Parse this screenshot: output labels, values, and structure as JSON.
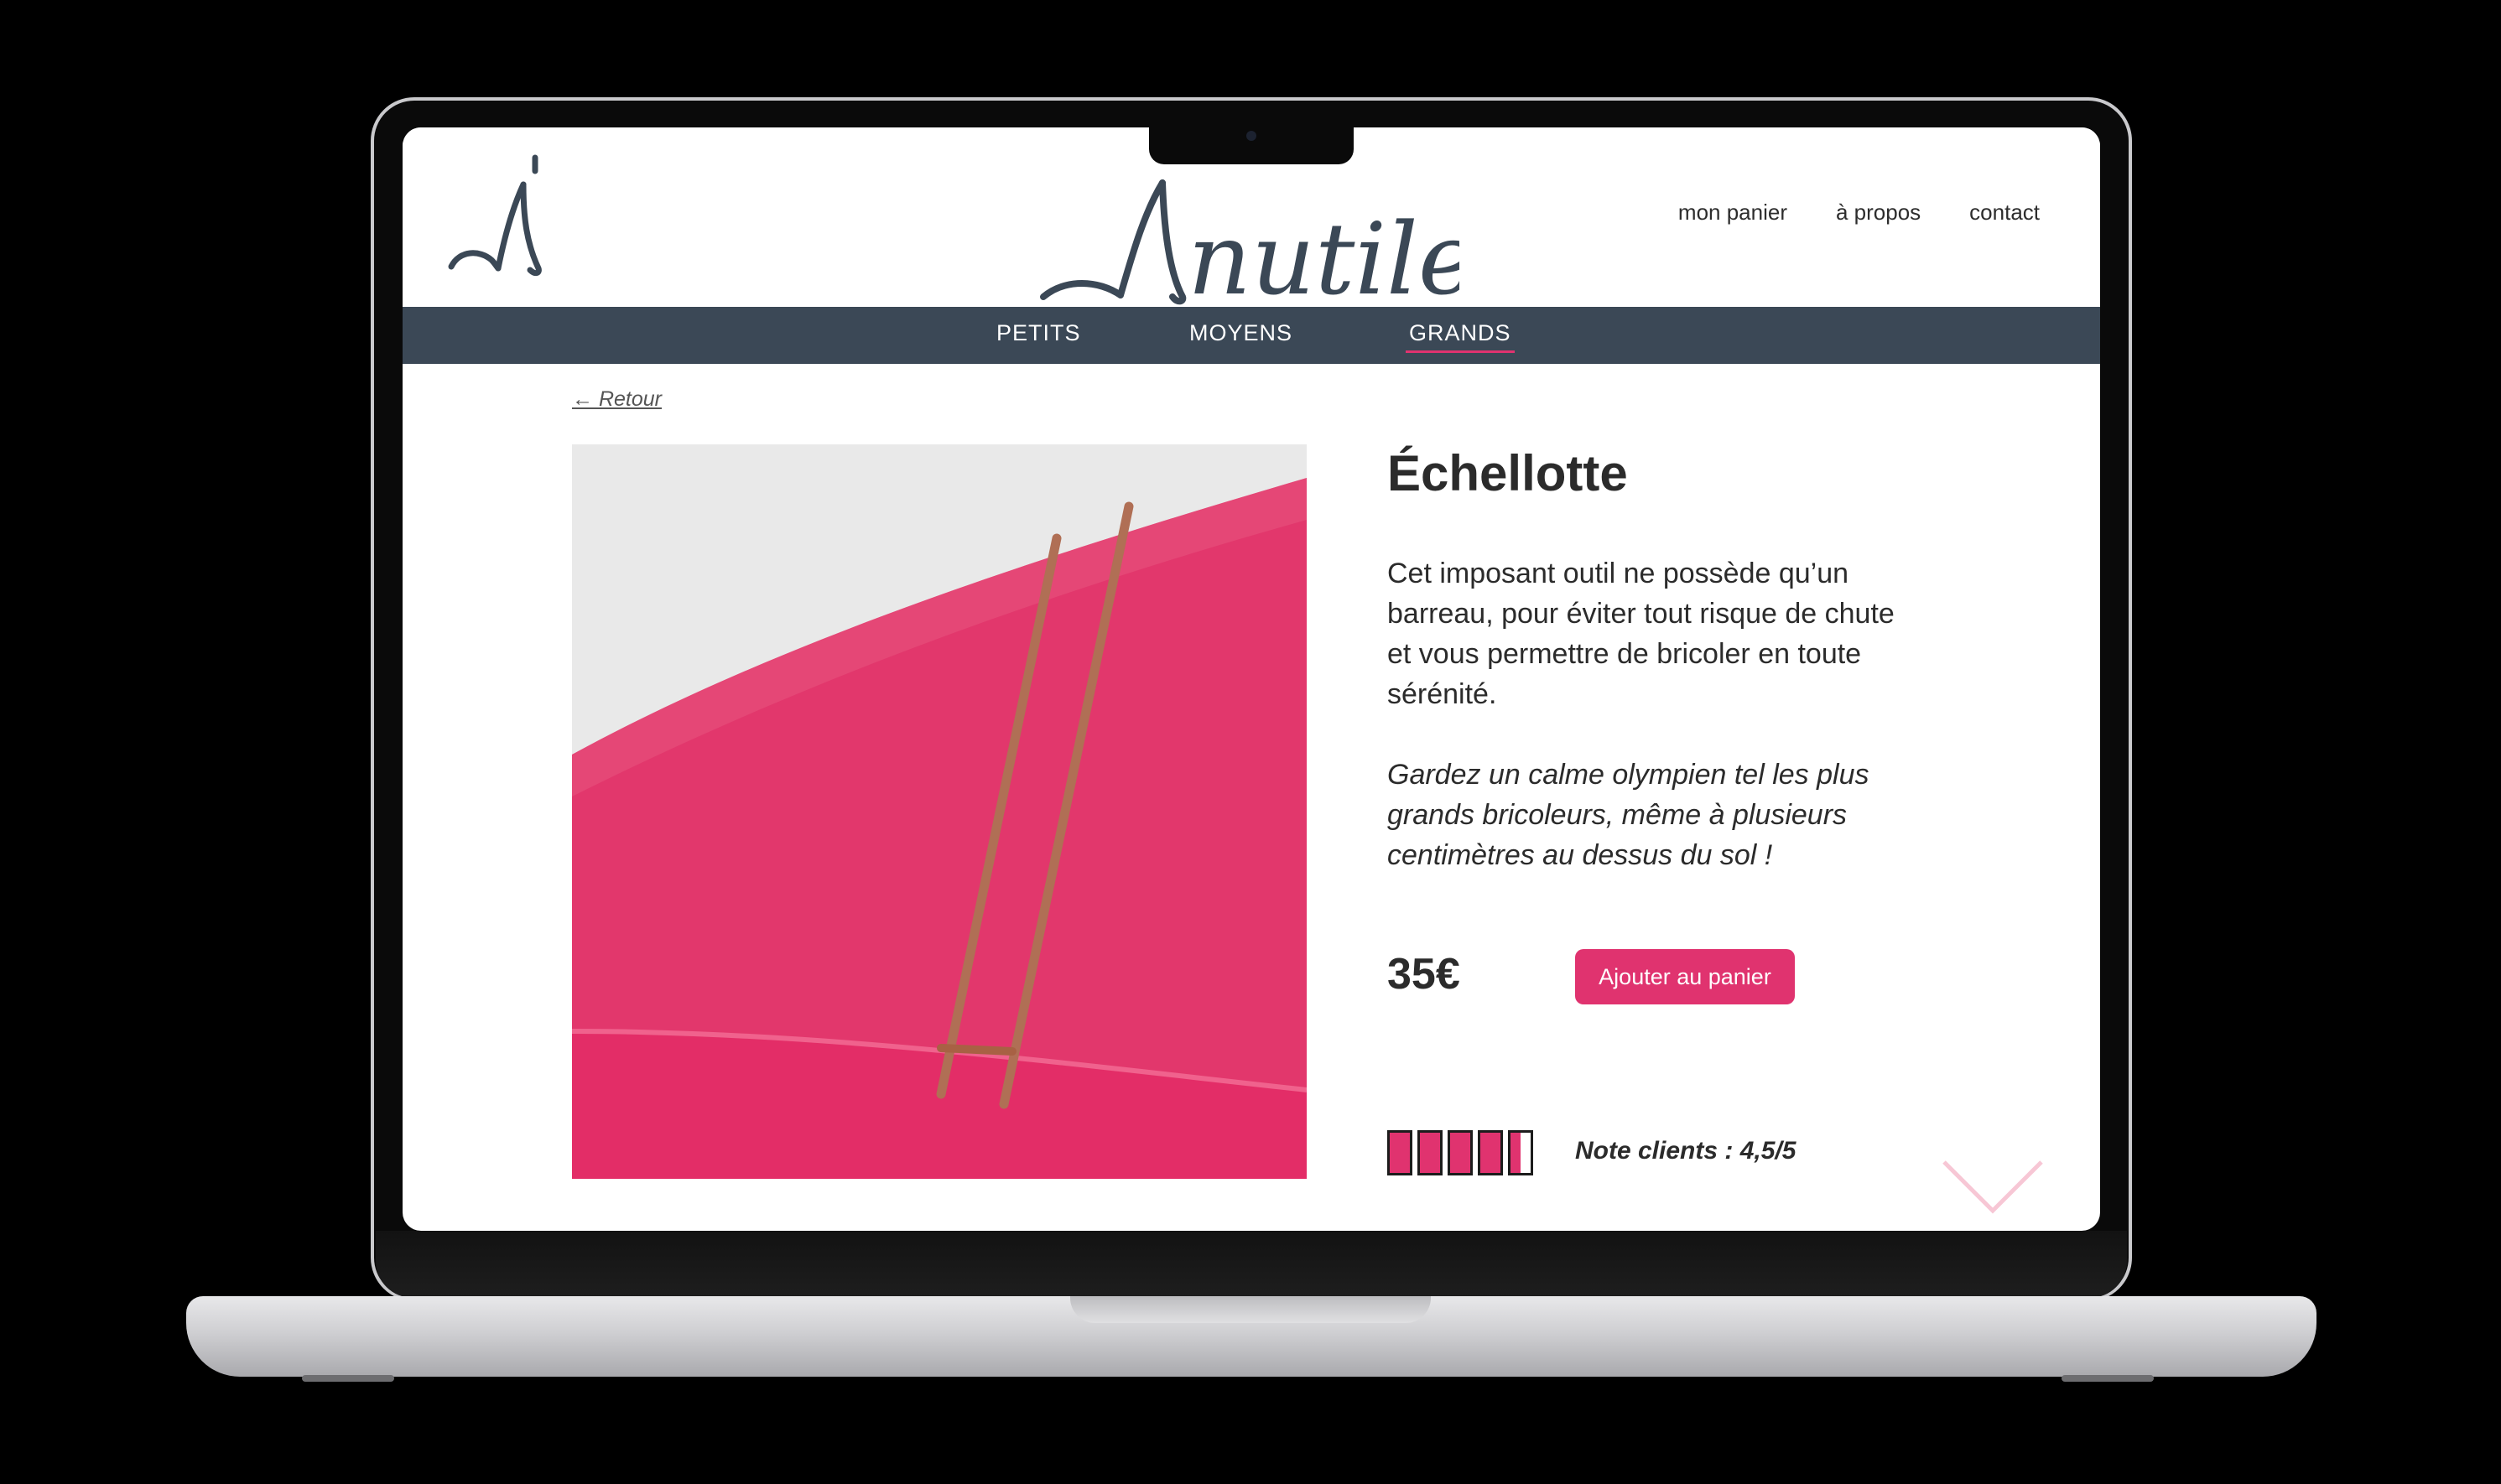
{
  "site": {
    "brand": "Inutile",
    "top_nav": [
      "mon panier",
      "à propos",
      "contact"
    ],
    "categories": [
      "PETITS",
      "MOYENS",
      "GRANDS"
    ],
    "active_category": "GRANDS"
  },
  "product": {
    "back_label": "← Retour",
    "title": "Échellotte",
    "description": "Cet imposant outil ne possède qu’un barreau, pour éviter tout risque de chute et vous permettre de bricoler en toute sérénité.",
    "tagline": "Gardez un calme olympien tel les plus grands bricoleurs, même à plusieurs centimètres au dessus du sol !",
    "price": "35€",
    "add_to_cart_label": "Ajouter au panier",
    "rating_label": "Note clients : 4,5/5",
    "rating_value": 4.5,
    "rating_max": 5
  },
  "colors": {
    "accent": "#e0336f",
    "nav_bar": "#3b4856",
    "text": "#2b2b2b"
  },
  "icons": [
    "logo-small-icon",
    "logo-wordmark-icon",
    "chevron-down-icon"
  ]
}
